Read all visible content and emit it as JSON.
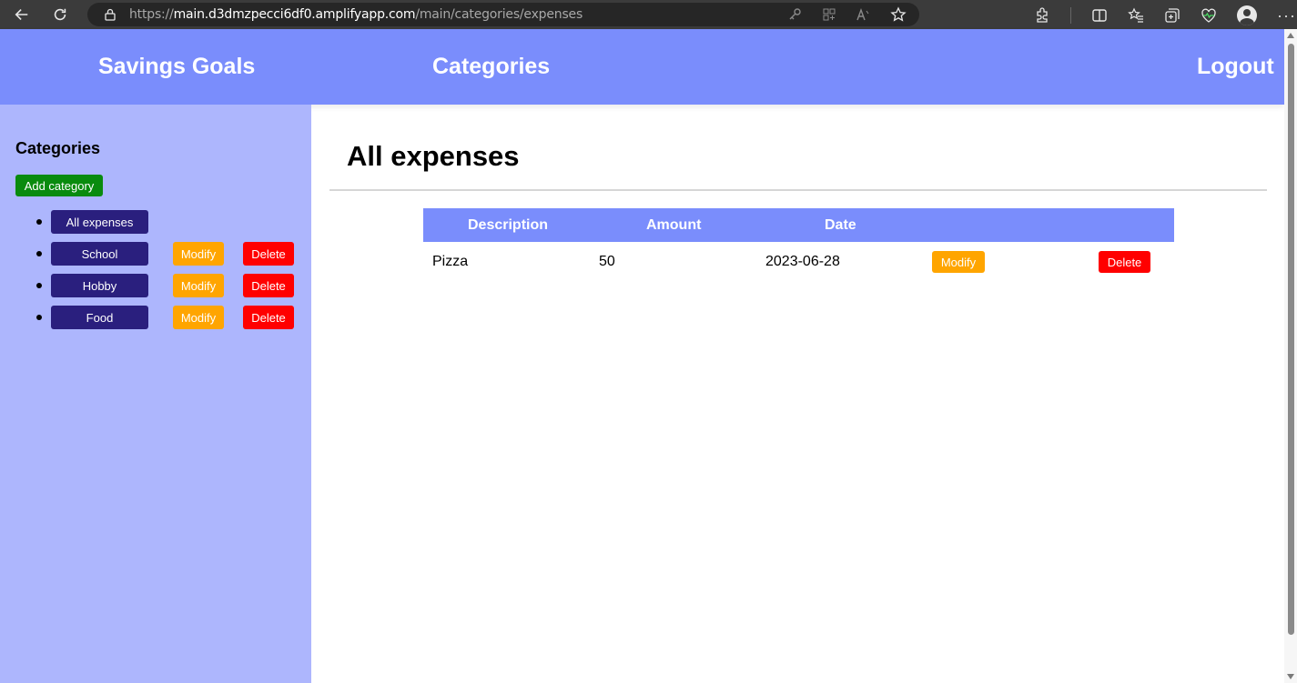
{
  "browser": {
    "url_prefix": "https://",
    "url_host": "main.d3dmzpecci6df0.amplifyapp.com",
    "url_path": "/main/categories/expenses"
  },
  "header": {
    "nav": [
      "Savings Goals",
      "Categories"
    ],
    "logout": "Logout"
  },
  "sidebar": {
    "title": "Categories",
    "add_button": "Add category",
    "categories": [
      {
        "label": "All expenses",
        "has_actions": false
      },
      {
        "label": "School",
        "modify": "Modify",
        "delete": "Delete"
      },
      {
        "label": "Hobby",
        "modify": "Modify",
        "delete": "Delete"
      },
      {
        "label": "Food",
        "modify": "Modify",
        "delete": "Delete"
      }
    ]
  },
  "main": {
    "title": "All expenses",
    "table": {
      "columns": [
        "Description",
        "Amount",
        "Date"
      ],
      "rows": [
        {
          "description": "Pizza",
          "amount": "50",
          "date": "2023-06-28",
          "modify": "Modify",
          "delete": "Delete"
        }
      ]
    }
  },
  "colors": {
    "header_bg": "#7a8dfc",
    "sidebar_bg": "#adb6fd",
    "category_btn": "#2a1f7e",
    "add_btn": "#098b0e",
    "modify_btn": "#ffa500",
    "delete_btn": "#ff0000"
  },
  "icons": [
    "back-arrow-icon",
    "refresh-icon",
    "lock-icon",
    "key-icon",
    "apps-icon",
    "read-aloud-icon",
    "star-icon",
    "extensions-icon",
    "split-screen-icon",
    "favorites-icon",
    "collections-icon",
    "health-icon",
    "profile-icon",
    "more-icon"
  ]
}
